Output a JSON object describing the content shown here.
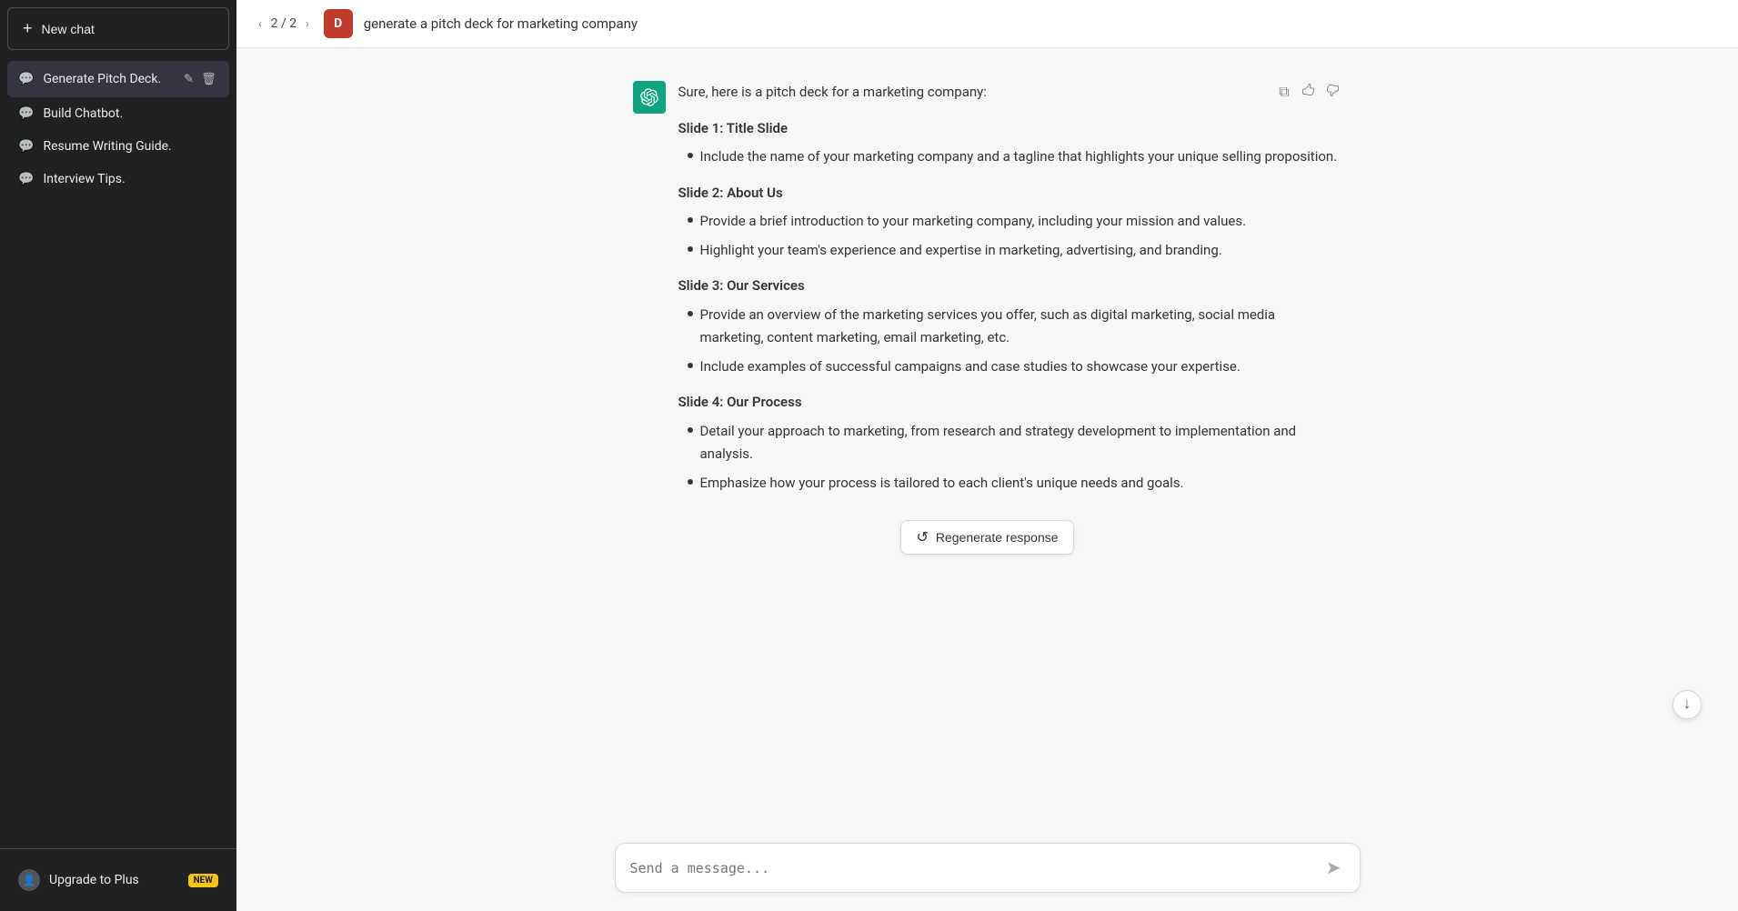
{
  "sidebar": {
    "new_chat_label": "New chat",
    "conversations": [
      {
        "id": "generate-pitch-deck",
        "label": "Generate Pitch Deck.",
        "active": true
      },
      {
        "id": "build-chatbot",
        "label": "Build Chatbot.",
        "active": false
      },
      {
        "id": "resume-writing-guide",
        "label": "Resume Writing Guide.",
        "active": false
      },
      {
        "id": "interview-tips",
        "label": "Interview Tips.",
        "active": false
      }
    ],
    "upgrade_label": "Upgrade to Plus",
    "new_badge": "NEW"
  },
  "header": {
    "nav": "2 / 2",
    "user_initial": "D",
    "title": "generate a pitch deck for marketing company"
  },
  "message": {
    "intro": "Sure, here is a pitch deck for a marketing company:",
    "slides": [
      {
        "heading": "Slide 1: Title Slide",
        "bullets": [
          "Include the name of your marketing company and a tagline that highlights your unique selling proposition."
        ]
      },
      {
        "heading": "Slide 2: About Us",
        "bullets": [
          "Provide a brief introduction to your marketing company, including your mission and values.",
          "Highlight your team's experience and expertise in marketing, advertising, and branding."
        ]
      },
      {
        "heading": "Slide 3: Our Services",
        "bullets": [
          "Provide an overview of the marketing services you offer, such as digital marketing, social media marketing, content marketing, email marketing, etc.",
          "Include examples of successful campaigns and case studies to showcase your expertise."
        ]
      },
      {
        "heading": "Slide 4: Our Process",
        "bullets": [
          "Detail your approach to marketing, from research and strategy development to implementation and analysis.",
          "Emphasize how your process is tailored to each client's unique needs and goals."
        ]
      }
    ]
  },
  "regenerate_label": "Regenerate response",
  "input_placeholder": "Send a message...",
  "icons": {
    "plus": "+",
    "chat": "💬",
    "edit": "✎",
    "delete": "🗑",
    "copy": "⧉",
    "thumbup": "👍",
    "thumbdown": "👎",
    "send": "➤",
    "regen": "↺",
    "chevron_left": "‹",
    "chevron_right": "›",
    "scroll_down": "↓",
    "user": "👤"
  },
  "colors": {
    "sidebar_bg": "#202123",
    "active_chat": "#343541",
    "gpt_avatar": "#10a37f",
    "user_avatar": "#c0392b",
    "badge_bg": "#f5c518"
  }
}
